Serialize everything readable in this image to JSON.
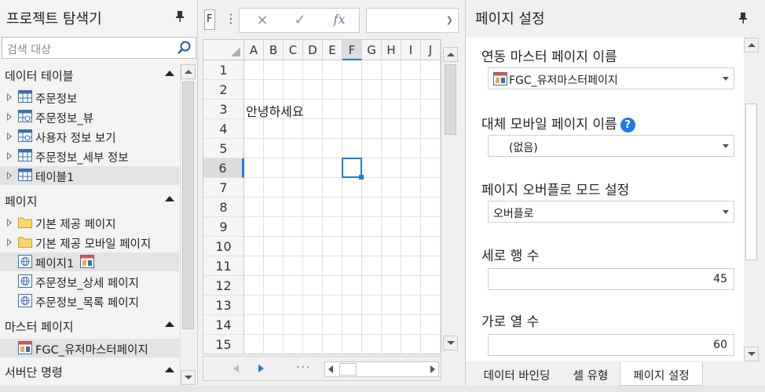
{
  "explorer": {
    "title": "프로젝트 탐색기",
    "search_placeholder": "검색 대상",
    "sections": {
      "tables": "데이터 테이블",
      "pages": "페이지",
      "master": "마스터 페이지",
      "server": "서버단 명령"
    },
    "table_items": [
      "주문정보",
      "주문정보_뷰",
      "사용자 정보 보기",
      "주문정보_세부 정보",
      "테이블1"
    ],
    "page_items": [
      "기본 제공 페이지",
      "기본 제공 모바일 페이지",
      "페이지1",
      "주문정보_상세 페이지",
      "주문정보_목록 페이지"
    ],
    "master_items": [
      "FGC_유저마스터페이지"
    ]
  },
  "sheet": {
    "cell_ref": "F",
    "columns": [
      "A",
      "B",
      "C",
      "D",
      "E",
      "F",
      "G",
      "H",
      "I",
      "J"
    ],
    "rows": [
      "1",
      "2",
      "3",
      "4",
      "5",
      "6",
      "7",
      "8",
      "9",
      "10",
      "11",
      "12",
      "13",
      "14",
      "15"
    ],
    "active_column": "F",
    "active_row": "6",
    "cell_A3": "안녕하세요",
    "cancel_icon": "×",
    "confirm_icon": "✓",
    "fx_label": "fx",
    "more_label": "⋮",
    "sheet_more": "···"
  },
  "settings": {
    "title": "페이지 설정",
    "linked_master_label": "연동 마스터 페이지 이름",
    "linked_master_value": "FGC_유저마스터페이지",
    "alt_mobile_label": "대체 모바일 페이지 이름",
    "alt_mobile_value": "(없음)",
    "overflow_label": "페이지 오버플로 모드 설정",
    "overflow_value": "오버플로",
    "rows_label": "세로 행 수",
    "rows_value": "45",
    "cols_label": "가로 열 수",
    "cols_value": "60",
    "help_glyph": "?"
  },
  "tabs": [
    "데이터 바인딩",
    "셀 유형",
    "페이지 설정"
  ],
  "active_tab": "페이지 설정",
  "colors": {
    "accent": "#1f7ae0",
    "folder": "#f5c542",
    "table_icon": "#3a6fb0"
  },
  "icons": {
    "pin": "pin-icon",
    "search": "search-icon",
    "help": "help-icon"
  }
}
